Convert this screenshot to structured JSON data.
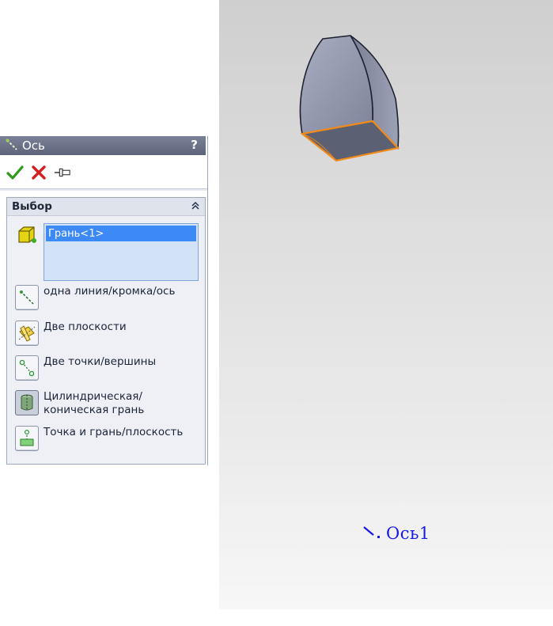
{
  "property_manager": {
    "title": "Ось",
    "help": "?",
    "actions": [
      {
        "name": "ok-icon"
      },
      {
        "name": "cancel-icon"
      },
      {
        "name": "pin-icon"
      }
    ],
    "group": {
      "label": "Выбор",
      "collapse_glyph": "⌃",
      "selection": [
        "Грань<1>"
      ],
      "options": [
        {
          "label": "одна линия/кромка/ось",
          "icon": "line-edge-axis-icon",
          "active": false
        },
        {
          "label": "Две плоскости",
          "icon": "two-planes-icon",
          "active": false
        },
        {
          "label": "Две точки/вершины",
          "icon": "two-points-icon",
          "active": false
        },
        {
          "label": "Цилиндрическая/коническая грань",
          "icon": "cylinder-face-icon",
          "active": true
        },
        {
          "label": "Точка и грань/плоскость",
          "icon": "point-face-icon",
          "active": false
        }
      ]
    }
  },
  "viewport": {
    "axis_label": "Ось1",
    "colors": {
      "face": "#8e93a8",
      "edge_highlight": "#f08a1a",
      "axis_label": "#1818e8"
    }
  }
}
